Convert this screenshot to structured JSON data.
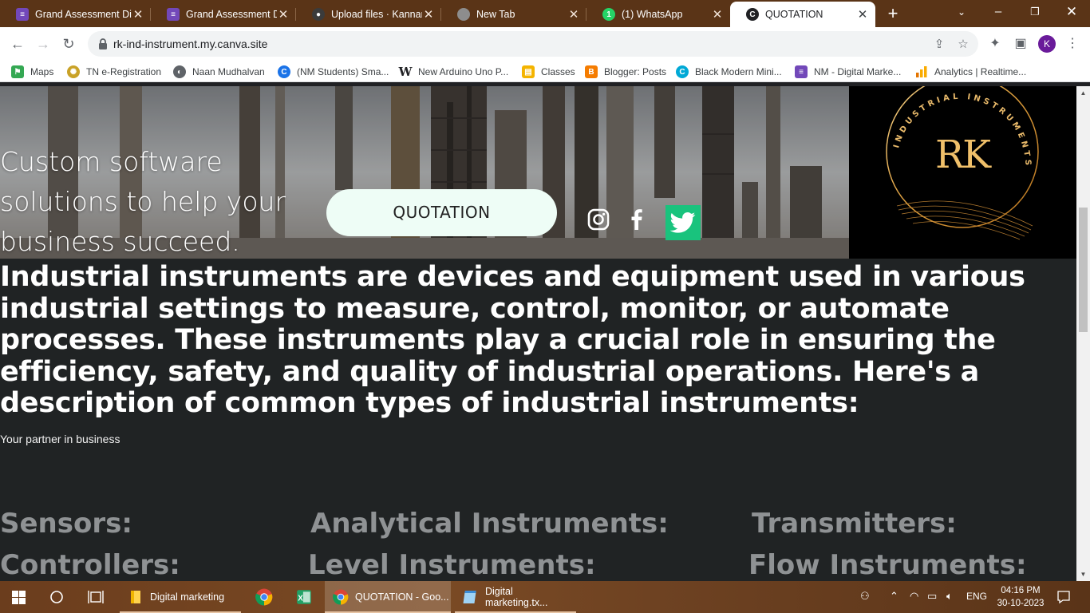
{
  "browser": {
    "tabs": [
      {
        "title": "Grand Assessment Di",
        "icon": "form-icon",
        "color": "#7248b9"
      },
      {
        "title": "Grand Assessment Di",
        "icon": "form-icon",
        "color": "#7248b9"
      },
      {
        "title": "Upload files · Kannan",
        "icon": "github-icon",
        "color": "#24292f"
      },
      {
        "title": "New Tab",
        "icon": "chrome-icon",
        "color": "#777777"
      },
      {
        "title": "(1) WhatsApp",
        "icon": "whatsapp-icon",
        "color": "#25d366"
      },
      {
        "title": "QUOTATION",
        "icon": "canva-icon",
        "color": "#202124"
      }
    ],
    "url": "rk-ind-instrument.my.canva.site",
    "profile_initial": "K"
  },
  "bookmarks": [
    {
      "label": "Maps",
      "icon": "maps-icon",
      "color": "#34a853"
    },
    {
      "label": "TN e-Registration",
      "icon": "tn-emblem-icon",
      "color": "#c9a227"
    },
    {
      "label": "Naan Mudhalvan",
      "icon": "globe-icon",
      "color": "#5f6368"
    },
    {
      "label": "(NM Students) Sma...",
      "icon": "c-icon",
      "color": "#1a73e8"
    },
    {
      "label": "New Arduino Uno P...",
      "icon": "w-icon",
      "color": "#202124"
    },
    {
      "label": "Classes",
      "icon": "classroom-icon",
      "color": "#f4b400"
    },
    {
      "label": "Blogger: Posts",
      "icon": "blogger-icon",
      "color": "#f57c00"
    },
    {
      "label": "Black Modern Mini...",
      "icon": "canva-icon",
      "color": "#00c4cc"
    },
    {
      "label": "NM - Digital Marke...",
      "icon": "form-icon",
      "color": "#7248b9"
    },
    {
      "label": "Analytics | Realtime...",
      "icon": "analytics-icon",
      "color": "#f9ab00"
    }
  ],
  "hero": {
    "text": "Custom software solutions to help your business succeed.",
    "button_label": "QUOTATION",
    "social": [
      "instagram-icon",
      "facebook-icon",
      "twitter-icon"
    ],
    "logo": {
      "initials": "RK",
      "arc_text": "INDUSTRIAL INSTRUMENTS"
    }
  },
  "content": {
    "headline": "Industrial instruments are devices and equipment used in various industrial settings to measure, control, monitor, or automate processes. These instruments play a crucial role in ensuring the efficiency, safety, and quality of industrial operations. Here's a description of common types of industrial instruments:",
    "tagline": "Your partner in business",
    "categories": [
      "Sensors:",
      "Analytical Instruments:",
      "Transmitters:",
      "Controllers:",
      "Level Instruments:",
      "Flow Instruments:"
    ]
  },
  "taskbar": {
    "apps": [
      {
        "label": "Digital marketing",
        "icon": "folder-icon"
      },
      {
        "label": "",
        "icon": "chrome-icon"
      },
      {
        "label": "",
        "icon": "excel-icon"
      },
      {
        "label": "QUOTATION - Goo...",
        "icon": "chrome-icon"
      },
      {
        "label": "Digital marketing.tx...",
        "icon": "notepad-icon"
      }
    ],
    "language": "ENG",
    "time": "04:16 PM",
    "date": "30-10-2023"
  }
}
